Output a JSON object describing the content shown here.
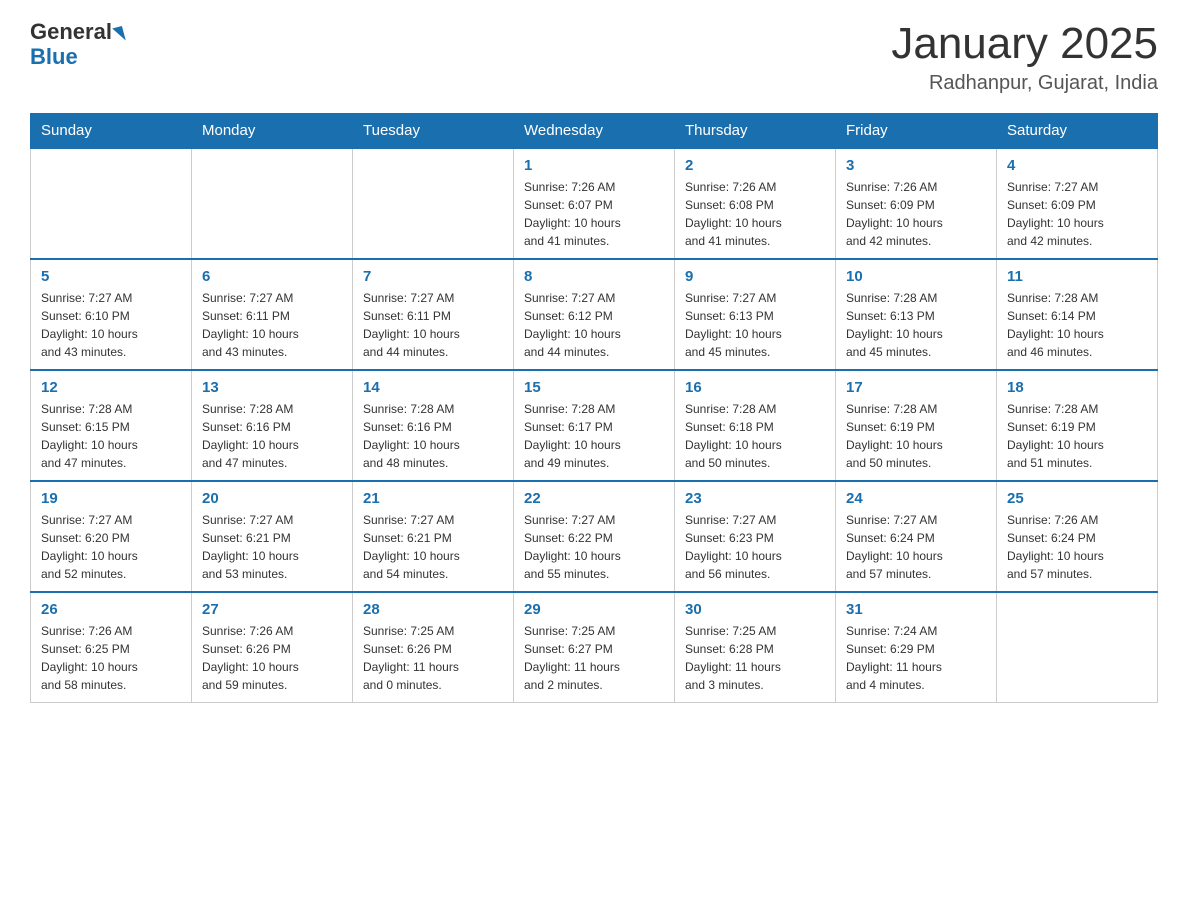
{
  "header": {
    "logo_general": "General",
    "logo_blue": "Blue",
    "title": "January 2025",
    "subtitle": "Radhanpur, Gujarat, India"
  },
  "days_of_week": [
    "Sunday",
    "Monday",
    "Tuesday",
    "Wednesday",
    "Thursday",
    "Friday",
    "Saturday"
  ],
  "weeks": [
    [
      {
        "day": "",
        "info": ""
      },
      {
        "day": "",
        "info": ""
      },
      {
        "day": "",
        "info": ""
      },
      {
        "day": "1",
        "info": "Sunrise: 7:26 AM\nSunset: 6:07 PM\nDaylight: 10 hours\nand 41 minutes."
      },
      {
        "day": "2",
        "info": "Sunrise: 7:26 AM\nSunset: 6:08 PM\nDaylight: 10 hours\nand 41 minutes."
      },
      {
        "day": "3",
        "info": "Sunrise: 7:26 AM\nSunset: 6:09 PM\nDaylight: 10 hours\nand 42 minutes."
      },
      {
        "day": "4",
        "info": "Sunrise: 7:27 AM\nSunset: 6:09 PM\nDaylight: 10 hours\nand 42 minutes."
      }
    ],
    [
      {
        "day": "5",
        "info": "Sunrise: 7:27 AM\nSunset: 6:10 PM\nDaylight: 10 hours\nand 43 minutes."
      },
      {
        "day": "6",
        "info": "Sunrise: 7:27 AM\nSunset: 6:11 PM\nDaylight: 10 hours\nand 43 minutes."
      },
      {
        "day": "7",
        "info": "Sunrise: 7:27 AM\nSunset: 6:11 PM\nDaylight: 10 hours\nand 44 minutes."
      },
      {
        "day": "8",
        "info": "Sunrise: 7:27 AM\nSunset: 6:12 PM\nDaylight: 10 hours\nand 44 minutes."
      },
      {
        "day": "9",
        "info": "Sunrise: 7:27 AM\nSunset: 6:13 PM\nDaylight: 10 hours\nand 45 minutes."
      },
      {
        "day": "10",
        "info": "Sunrise: 7:28 AM\nSunset: 6:13 PM\nDaylight: 10 hours\nand 45 minutes."
      },
      {
        "day": "11",
        "info": "Sunrise: 7:28 AM\nSunset: 6:14 PM\nDaylight: 10 hours\nand 46 minutes."
      }
    ],
    [
      {
        "day": "12",
        "info": "Sunrise: 7:28 AM\nSunset: 6:15 PM\nDaylight: 10 hours\nand 47 minutes."
      },
      {
        "day": "13",
        "info": "Sunrise: 7:28 AM\nSunset: 6:16 PM\nDaylight: 10 hours\nand 47 minutes."
      },
      {
        "day": "14",
        "info": "Sunrise: 7:28 AM\nSunset: 6:16 PM\nDaylight: 10 hours\nand 48 minutes."
      },
      {
        "day": "15",
        "info": "Sunrise: 7:28 AM\nSunset: 6:17 PM\nDaylight: 10 hours\nand 49 minutes."
      },
      {
        "day": "16",
        "info": "Sunrise: 7:28 AM\nSunset: 6:18 PM\nDaylight: 10 hours\nand 50 minutes."
      },
      {
        "day": "17",
        "info": "Sunrise: 7:28 AM\nSunset: 6:19 PM\nDaylight: 10 hours\nand 50 minutes."
      },
      {
        "day": "18",
        "info": "Sunrise: 7:28 AM\nSunset: 6:19 PM\nDaylight: 10 hours\nand 51 minutes."
      }
    ],
    [
      {
        "day": "19",
        "info": "Sunrise: 7:27 AM\nSunset: 6:20 PM\nDaylight: 10 hours\nand 52 minutes."
      },
      {
        "day": "20",
        "info": "Sunrise: 7:27 AM\nSunset: 6:21 PM\nDaylight: 10 hours\nand 53 minutes."
      },
      {
        "day": "21",
        "info": "Sunrise: 7:27 AM\nSunset: 6:21 PM\nDaylight: 10 hours\nand 54 minutes."
      },
      {
        "day": "22",
        "info": "Sunrise: 7:27 AM\nSunset: 6:22 PM\nDaylight: 10 hours\nand 55 minutes."
      },
      {
        "day": "23",
        "info": "Sunrise: 7:27 AM\nSunset: 6:23 PM\nDaylight: 10 hours\nand 56 minutes."
      },
      {
        "day": "24",
        "info": "Sunrise: 7:27 AM\nSunset: 6:24 PM\nDaylight: 10 hours\nand 57 minutes."
      },
      {
        "day": "25",
        "info": "Sunrise: 7:26 AM\nSunset: 6:24 PM\nDaylight: 10 hours\nand 57 minutes."
      }
    ],
    [
      {
        "day": "26",
        "info": "Sunrise: 7:26 AM\nSunset: 6:25 PM\nDaylight: 10 hours\nand 58 minutes."
      },
      {
        "day": "27",
        "info": "Sunrise: 7:26 AM\nSunset: 6:26 PM\nDaylight: 10 hours\nand 59 minutes."
      },
      {
        "day": "28",
        "info": "Sunrise: 7:25 AM\nSunset: 6:26 PM\nDaylight: 11 hours\nand 0 minutes."
      },
      {
        "day": "29",
        "info": "Sunrise: 7:25 AM\nSunset: 6:27 PM\nDaylight: 11 hours\nand 2 minutes."
      },
      {
        "day": "30",
        "info": "Sunrise: 7:25 AM\nSunset: 6:28 PM\nDaylight: 11 hours\nand 3 minutes."
      },
      {
        "day": "31",
        "info": "Sunrise: 7:24 AM\nSunset: 6:29 PM\nDaylight: 11 hours\nand 4 minutes."
      },
      {
        "day": "",
        "info": ""
      }
    ]
  ]
}
